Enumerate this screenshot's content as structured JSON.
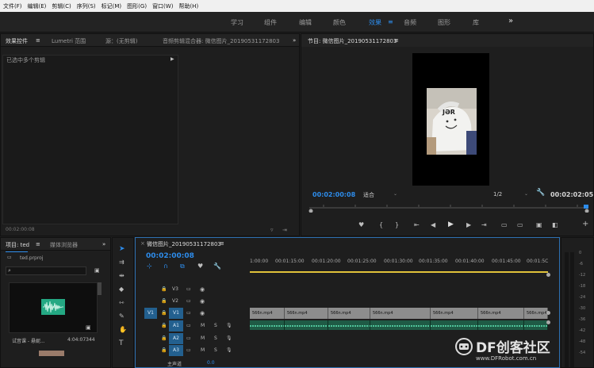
{
  "menu": [
    "文件(F)",
    "编辑(E)",
    "剪辑(C)",
    "序列(S)",
    "标记(M)",
    "图形(G)",
    "窗口(W)",
    "帮助(H)"
  ],
  "workspaces": [
    "学习",
    "组件",
    "编辑",
    "颜色",
    "效果",
    "音频",
    "图形",
    "库"
  ],
  "workspace_active": "效果",
  "workspace_more": "»",
  "effect_controls": {
    "tab_effect_controls": "效果控件",
    "tab_menu": "≡",
    "tab_lumetri": "Lumetri 范围",
    "tab_source": "源：(无剪辑)",
    "tab_audio_mixer": "音频剪辑混合器: 微信图片_20190531172803",
    "more": "»",
    "no_clip": "已选中多个剪辑",
    "timecode": "00:02:00:08"
  },
  "program": {
    "title": "节目: 微信图片_20190531172803",
    "menu": "≡",
    "timecode": "00:02:00:08",
    "fit": "适合",
    "resolution": "1/2",
    "duration": "00:02:02:05",
    "image_text": "JƏR"
  },
  "project": {
    "tab_project": "项目: ted",
    "tab_menu": "≡",
    "tab_media": "媒体浏览器",
    "more": "»",
    "file": "ted.prproj",
    "search_placeholder": "",
    "clip_name": "试音课 - 悬妮...",
    "clip_duration": "4:04:07344"
  },
  "timeline": {
    "close": "×",
    "title": "微信图片_20190531172803",
    "menu": "≡",
    "timecode": "00:02:00:08",
    "ruler": [
      "1:00:00",
      "00:01:15:00",
      "00:01:20:00",
      "00:01:25:00",
      "00:01:30:00",
      "00:01:35:00",
      "00:01:40:00",
      "00:01:45:00",
      "00:01:5C"
    ],
    "tracks": [
      {
        "name": "V3",
        "src": ""
      },
      {
        "name": "V2",
        "src": ""
      },
      {
        "name": "V1",
        "src": "V1"
      },
      {
        "name": "A1",
        "src": ""
      },
      {
        "name": "A2",
        "src": ""
      },
      {
        "name": "A3",
        "src": ""
      }
    ],
    "master": "主声道",
    "master_value": "0.0",
    "clip_label": "566n.mp4",
    "mute": "M",
    "solo": "S"
  },
  "meter_scale": [
    "0",
    "-6",
    "-12",
    "-18",
    "-24",
    "-30",
    "-36",
    "-42",
    "-48",
    "-54"
  ],
  "watermark": {
    "brand": "DF创客社区",
    "url": "www.DFRobot.com.cn"
  }
}
